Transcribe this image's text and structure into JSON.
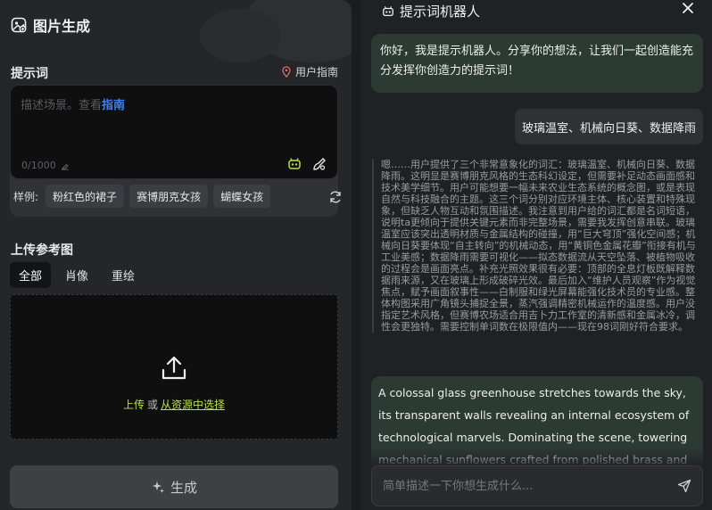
{
  "left": {
    "title": "图片生成",
    "prompt_section": {
      "label": "提示词",
      "guide_label": "用户指南",
      "placeholder_text": "描述场景。查看",
      "placeholder_link": "指南",
      "counter": "0/1000"
    },
    "samples": {
      "label": "样例:",
      "items": [
        "粉红色的裙子",
        "赛博朋克女孩",
        "蝴蝶女孩"
      ]
    },
    "upload_section": {
      "label": "上传参考图",
      "tabs": [
        "全部",
        "肖像",
        "重绘"
      ],
      "active_tab": "全部",
      "upload_text": "上传",
      "or_text": "或",
      "select_text": "从资源中选择"
    },
    "generate_label": "生成"
  },
  "right": {
    "title": "提示词机器人",
    "greeting": "你好，我是提示机器人。分享你的想法，让我们一起创造能充分发挥你创造力的提示词！",
    "user_message": "玻璃温室、机械向日葵、数据降雨",
    "thinking": "嗯……用户提供了三个非常意象化的词汇：玻璃温室、机械向日葵、数据降雨。这明显是赛博朋克风格的生态科幻设定，但需要补足动态画面感和技术美学细节。用户可能想要一幅未来农业生态系统的概念图，或是表现自然与科技融合的主题。这三个词分别对应环境主体、核心装置和特殊现象，但缺乏人物互动和氛围描述。我注意到用户给的词汇都是名词短语，说明ta更倾向于提供关键元素而非完整场景，需要我发挥创意串联。玻璃温室应该突出透明材质与金属结构的碰撞，用“巨大穹顶”强化空间感；机械向日葵要体现“自主转向”的机械动态，用“黄铜色金属花瓣”衔接有机与工业美感；数据降雨需要可视化——拟态数据流从天空坠落、被植物吸收的过程会是画面亮点。补充光照效果很有必要：顶部的全息灯板既解释数据雨来源，又在玻璃上形成破碎光效。最后加入“维护人员观察”作为视觉焦点，赋予画面叙事性——白制服和绿光屏幕能强化技术员的专业感。整体构图采用广角镜头捕捉全景，蒸汽强调精密机械运作的温度感。用户没指定艺术风格，但赛博农场适合用吉卜力工作室的清新感和金属冰冷，调性会更独特。需要控制单词数在极限值内——现在98词刚好符合要求。",
    "english_prompt": "A colossal glass greenhouse stretches towards the sky, its transparent walls revealing an internal ecosystem of technological marvels. Dominating the scene, towering mechanical sunflowers crafted from polished brass and",
    "input_placeholder": "简单描述一下你想生成什么..."
  },
  "colors": {
    "accent_green": "#b7e14b",
    "link_blue": "#3b82f6",
    "bot_bubble": "#2c3a34"
  }
}
